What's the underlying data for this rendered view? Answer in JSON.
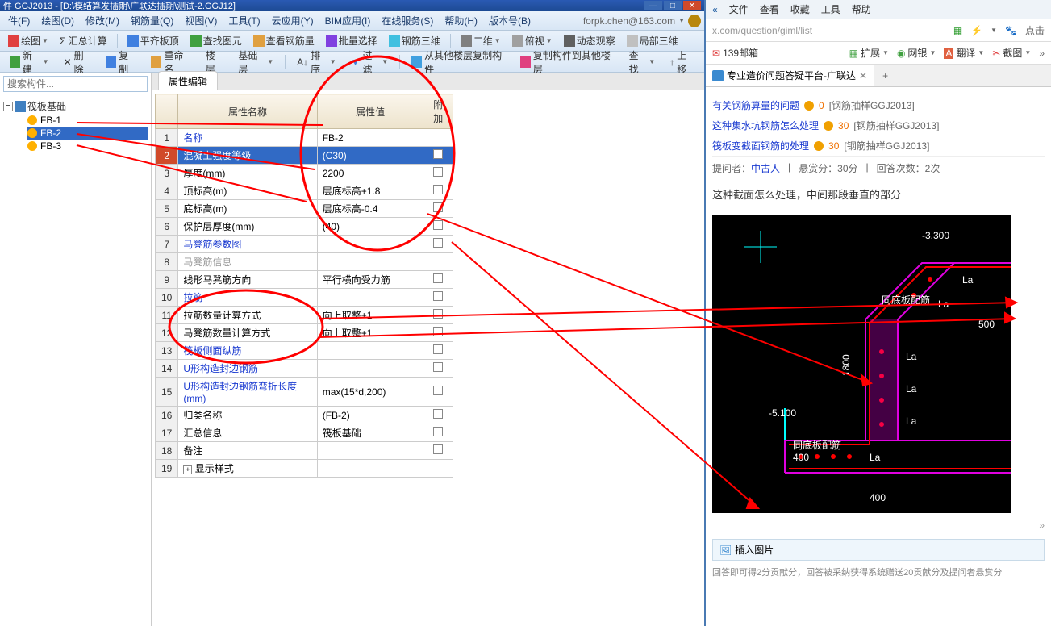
{
  "titlebar": "件 GGJ2013 - [D:\\模结算发插期\\广联达插期\\测试-2.GGJ12]",
  "menubar": [
    "件(F)",
    "绘图(D)",
    "修改(M)",
    "钢筋量(Q)",
    "视图(V)",
    "工具(T)",
    "云应用(Y)",
    "BIM应用(I)",
    "在线服务(S)",
    "帮助(H)",
    "版本号(B)"
  ],
  "user": "forpk.chen@163.com",
  "toolbar1": [
    "绘图",
    "Σ 汇总计算",
    "平齐板顶",
    "查找图元",
    "查看钢筋量",
    "批量选择",
    "钢筋三维",
    "二维",
    "俯视",
    "动态观察",
    "局部三维"
  ],
  "toolbar2": {
    "new": "新建",
    "del": "删除",
    "copy": "复制",
    "rename": "重命名",
    "floor": "楼层",
    "basefloor": "基础层",
    "sort": "排序",
    "filter": "过滤",
    "copyfrom": "从其他楼层复制构件",
    "copyto": "复制构件到其他楼层",
    "find": "查找",
    "up": "上移"
  },
  "search_placeholder": "搜索构件...",
  "tree": {
    "root": "筏板基础",
    "items": [
      "FB-1",
      "FB-2",
      "FB-3"
    ],
    "selected": 1
  },
  "tabs": [
    "属性编辑"
  ],
  "prop_header": {
    "name": "属性名称",
    "value": "属性值",
    "extra": "附加"
  },
  "props": [
    {
      "n": "名称",
      "v": "FB-2",
      "link": true,
      "chk": false
    },
    {
      "n": "混凝土强度等级",
      "v": "(C30)",
      "link": false,
      "chk": true,
      "sel": true
    },
    {
      "n": "厚度(mm)",
      "v": "2200",
      "link": false,
      "chk": true
    },
    {
      "n": "顶标高(m)",
      "v": "层底标高+1.8",
      "link": false,
      "chk": true
    },
    {
      "n": "底标高(m)",
      "v": "层底标高-0.4",
      "link": false,
      "chk": true
    },
    {
      "n": "保护层厚度(mm)",
      "v": "(40)",
      "link": false,
      "chk": true
    },
    {
      "n": "马凳筋参数图",
      "v": "",
      "link": true,
      "chk": true
    },
    {
      "n": "马凳筋信息",
      "v": "",
      "link": false,
      "chk": false,
      "dim": true
    },
    {
      "n": "线形马凳筋方向",
      "v": "平行横向受力筋",
      "link": false,
      "chk": true
    },
    {
      "n": "拉筋",
      "v": "",
      "link": true,
      "chk": true
    },
    {
      "n": "拉筋数量计算方式",
      "v": "向上取整+1",
      "link": false,
      "chk": true
    },
    {
      "n": "马凳筋数量计算方式",
      "v": "向上取整+1",
      "link": false,
      "chk": true
    },
    {
      "n": "筏板侧面纵筋",
      "v": "",
      "link": true,
      "chk": true
    },
    {
      "n": "U形构造封边钢筋",
      "v": "",
      "link": true,
      "chk": true
    },
    {
      "n": "U形构造封边钢筋弯折长度(mm)",
      "v": "max(15*d,200)",
      "link": true,
      "chk": true
    },
    {
      "n": "归类名称",
      "v": "(FB-2)",
      "link": false,
      "chk": true
    },
    {
      "n": "汇总信息",
      "v": "筏板基础",
      "link": false,
      "chk": true
    },
    {
      "n": "备注",
      "v": "",
      "link": false,
      "chk": true
    },
    {
      "n": "显示样式",
      "v": "",
      "link": false,
      "chk": false,
      "expand": true
    }
  ],
  "browser": {
    "menus": [
      "文件",
      "查看",
      "收藏",
      "工具",
      "帮助"
    ],
    "url": "x.com/question/giml/list",
    "bookmarks": [
      {
        "icon": "mail",
        "label": "139邮箱"
      },
      {
        "icon": "ext",
        "label": "扩展"
      },
      {
        "icon": "bank",
        "label": "网银"
      },
      {
        "icon": "trans",
        "label": "翻译"
      },
      {
        "icon": "shot",
        "label": "截图"
      }
    ],
    "tab_title": "专业造价问题答疑平台-广联达",
    "qa_links": [
      {
        "title": "有关钢筋算量的问题",
        "pts": "0",
        "tag": "[钢筋抽样GGJ2013]"
      },
      {
        "title": "这种集水坑钢筋怎么处理",
        "pts": "30",
        "tag": "[钢筋抽样GGJ2013]"
      },
      {
        "title": "筏板变截面钢筋的处理",
        "pts": "30",
        "tag": "[钢筋抽样GGJ2013]"
      }
    ],
    "meta": {
      "ask": "提问者：",
      "author": "中古人",
      "bounty": "悬赏分：30分",
      "answers": "回答次数：2次"
    },
    "desc": "这种截面怎么处理，中间那段垂直的部分",
    "insert": "插入图片",
    "footer": "回答即可得2分贡献分，回答被采纳获得系统赠送20贡献分及提问者悬赏分",
    "icons": {
      "fav": "★",
      "refresh": "↻",
      "dot": "点击"
    },
    "cad": {
      "d1": "-3.300",
      "d2": "-5.100",
      "h": "1800",
      "w": "400",
      "w2": "400",
      "w3": "500",
      "la": "La",
      "t1": "同底板配筋",
      "t2": "同底板配筋"
    }
  }
}
